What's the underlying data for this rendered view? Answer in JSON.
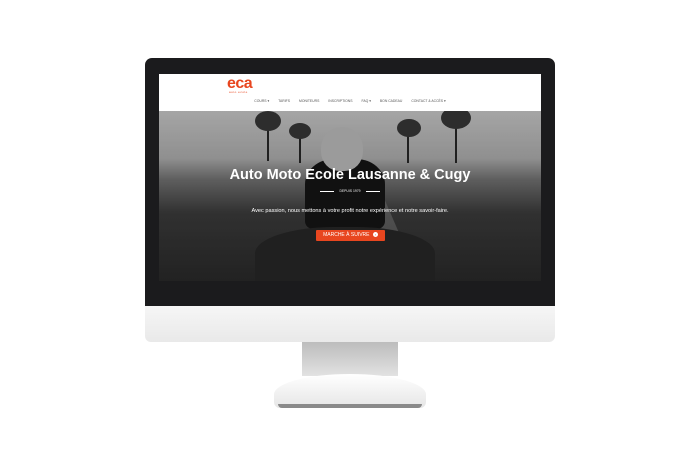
{
  "logo": {
    "text": "eca",
    "subtext": "auto ecole"
  },
  "nav": {
    "items": [
      {
        "label": "COURS ▾"
      },
      {
        "label": "TARIFS"
      },
      {
        "label": "MONITEURS"
      },
      {
        "label": "INSCRIPTIONS"
      },
      {
        "label": "FAQ ▾"
      },
      {
        "label": "BON CADEAU"
      },
      {
        "label": "CONTACT & ACCÈS ▾"
      }
    ]
  },
  "hero": {
    "title": "Auto Moto Ecole Lausanne & Cugy",
    "since": "DEPUIS 1979",
    "tagline": "Avec passion, nous mettons à votre profit notre expérience et notre savoir-faire.",
    "cta_label": "MARCHE À SUIVRE",
    "cta_icon": "arrow-circle-icon"
  },
  "colors": {
    "accent": "#e8461f",
    "bezel": "#1b1b1d"
  }
}
